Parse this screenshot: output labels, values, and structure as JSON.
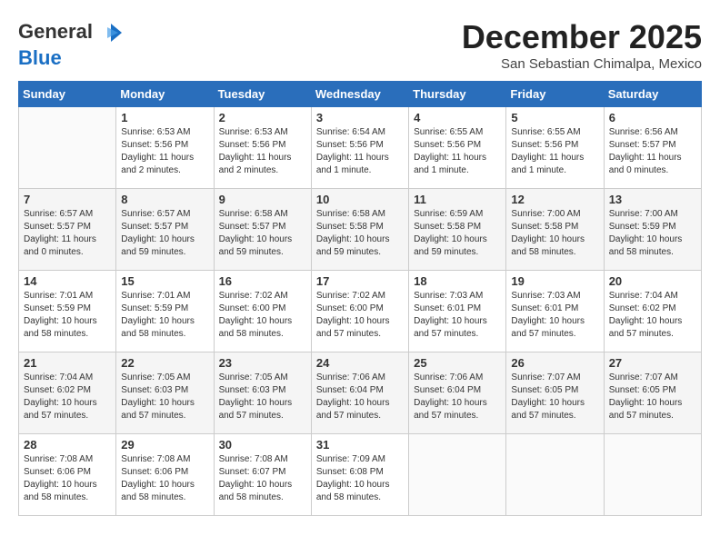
{
  "header": {
    "logo_line1": "General",
    "logo_line2": "Blue",
    "month_title": "December 2025",
    "location": "San Sebastian Chimalpa, Mexico"
  },
  "weekdays": [
    "Sunday",
    "Monday",
    "Tuesday",
    "Wednesday",
    "Thursday",
    "Friday",
    "Saturday"
  ],
  "weeks": [
    [
      {
        "day": "",
        "info": ""
      },
      {
        "day": "1",
        "info": "Sunrise: 6:53 AM\nSunset: 5:56 PM\nDaylight: 11 hours\nand 2 minutes."
      },
      {
        "day": "2",
        "info": "Sunrise: 6:53 AM\nSunset: 5:56 PM\nDaylight: 11 hours\nand 2 minutes."
      },
      {
        "day": "3",
        "info": "Sunrise: 6:54 AM\nSunset: 5:56 PM\nDaylight: 11 hours\nand 1 minute."
      },
      {
        "day": "4",
        "info": "Sunrise: 6:55 AM\nSunset: 5:56 PM\nDaylight: 11 hours\nand 1 minute."
      },
      {
        "day": "5",
        "info": "Sunrise: 6:55 AM\nSunset: 5:56 PM\nDaylight: 11 hours\nand 1 minute."
      },
      {
        "day": "6",
        "info": "Sunrise: 6:56 AM\nSunset: 5:57 PM\nDaylight: 11 hours\nand 0 minutes."
      }
    ],
    [
      {
        "day": "7",
        "info": "Sunrise: 6:57 AM\nSunset: 5:57 PM\nDaylight: 11 hours\nand 0 minutes."
      },
      {
        "day": "8",
        "info": "Sunrise: 6:57 AM\nSunset: 5:57 PM\nDaylight: 10 hours\nand 59 minutes."
      },
      {
        "day": "9",
        "info": "Sunrise: 6:58 AM\nSunset: 5:57 PM\nDaylight: 10 hours\nand 59 minutes."
      },
      {
        "day": "10",
        "info": "Sunrise: 6:58 AM\nSunset: 5:58 PM\nDaylight: 10 hours\nand 59 minutes."
      },
      {
        "day": "11",
        "info": "Sunrise: 6:59 AM\nSunset: 5:58 PM\nDaylight: 10 hours\nand 59 minutes."
      },
      {
        "day": "12",
        "info": "Sunrise: 7:00 AM\nSunset: 5:58 PM\nDaylight: 10 hours\nand 58 minutes."
      },
      {
        "day": "13",
        "info": "Sunrise: 7:00 AM\nSunset: 5:59 PM\nDaylight: 10 hours\nand 58 minutes."
      }
    ],
    [
      {
        "day": "14",
        "info": "Sunrise: 7:01 AM\nSunset: 5:59 PM\nDaylight: 10 hours\nand 58 minutes."
      },
      {
        "day": "15",
        "info": "Sunrise: 7:01 AM\nSunset: 5:59 PM\nDaylight: 10 hours\nand 58 minutes."
      },
      {
        "day": "16",
        "info": "Sunrise: 7:02 AM\nSunset: 6:00 PM\nDaylight: 10 hours\nand 58 minutes."
      },
      {
        "day": "17",
        "info": "Sunrise: 7:02 AM\nSunset: 6:00 PM\nDaylight: 10 hours\nand 57 minutes."
      },
      {
        "day": "18",
        "info": "Sunrise: 7:03 AM\nSunset: 6:01 PM\nDaylight: 10 hours\nand 57 minutes."
      },
      {
        "day": "19",
        "info": "Sunrise: 7:03 AM\nSunset: 6:01 PM\nDaylight: 10 hours\nand 57 minutes."
      },
      {
        "day": "20",
        "info": "Sunrise: 7:04 AM\nSunset: 6:02 PM\nDaylight: 10 hours\nand 57 minutes."
      }
    ],
    [
      {
        "day": "21",
        "info": "Sunrise: 7:04 AM\nSunset: 6:02 PM\nDaylight: 10 hours\nand 57 minutes."
      },
      {
        "day": "22",
        "info": "Sunrise: 7:05 AM\nSunset: 6:03 PM\nDaylight: 10 hours\nand 57 minutes."
      },
      {
        "day": "23",
        "info": "Sunrise: 7:05 AM\nSunset: 6:03 PM\nDaylight: 10 hours\nand 57 minutes."
      },
      {
        "day": "24",
        "info": "Sunrise: 7:06 AM\nSunset: 6:04 PM\nDaylight: 10 hours\nand 57 minutes."
      },
      {
        "day": "25",
        "info": "Sunrise: 7:06 AM\nSunset: 6:04 PM\nDaylight: 10 hours\nand 57 minutes."
      },
      {
        "day": "26",
        "info": "Sunrise: 7:07 AM\nSunset: 6:05 PM\nDaylight: 10 hours\nand 57 minutes."
      },
      {
        "day": "27",
        "info": "Sunrise: 7:07 AM\nSunset: 6:05 PM\nDaylight: 10 hours\nand 57 minutes."
      }
    ],
    [
      {
        "day": "28",
        "info": "Sunrise: 7:08 AM\nSunset: 6:06 PM\nDaylight: 10 hours\nand 58 minutes."
      },
      {
        "day": "29",
        "info": "Sunrise: 7:08 AM\nSunset: 6:06 PM\nDaylight: 10 hours\nand 58 minutes."
      },
      {
        "day": "30",
        "info": "Sunrise: 7:08 AM\nSunset: 6:07 PM\nDaylight: 10 hours\nand 58 minutes."
      },
      {
        "day": "31",
        "info": "Sunrise: 7:09 AM\nSunset: 6:08 PM\nDaylight: 10 hours\nand 58 minutes."
      },
      {
        "day": "",
        "info": ""
      },
      {
        "day": "",
        "info": ""
      },
      {
        "day": "",
        "info": ""
      }
    ]
  ]
}
